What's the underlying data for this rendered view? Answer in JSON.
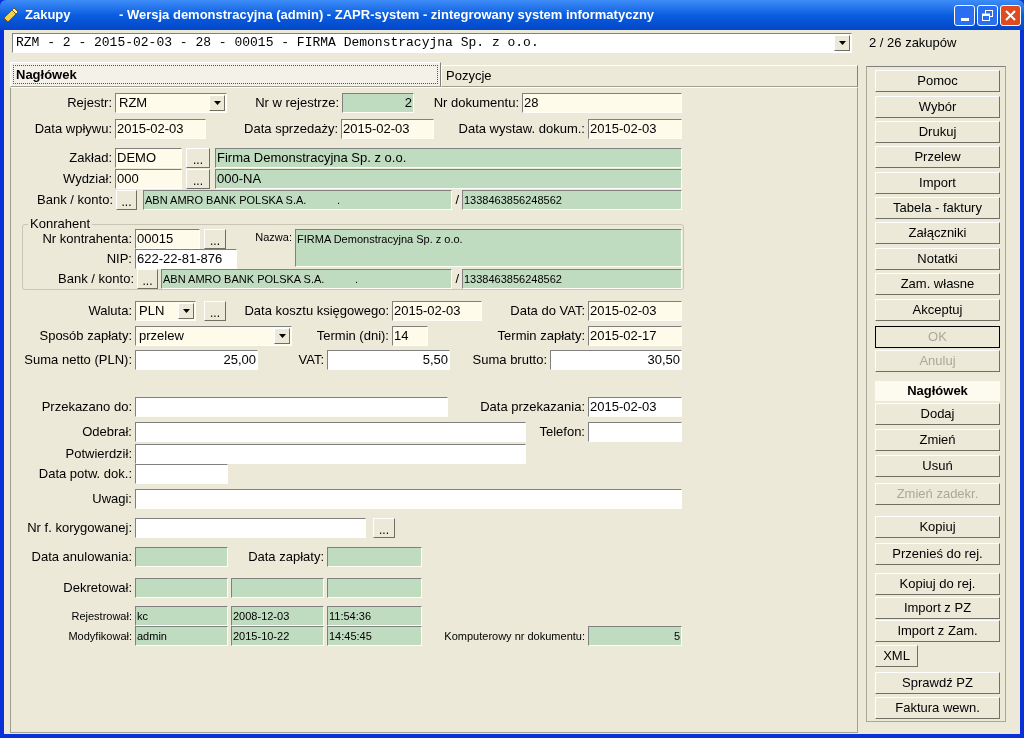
{
  "window": {
    "title": "Zakupy",
    "subtitle": "- Wersja demonstracyjna (admin) - ZAPR-system - zintegrowany system informatyczny"
  },
  "record_selector": {
    "value": "RZM - 2 - 2015-02-03 - 28 - 00015 - FIRMA Demonstracyjna Sp. z o.o."
  },
  "record_counter": "2 / 26 zakupów",
  "tabs": [
    {
      "label": "Nagłówek",
      "selected": true
    },
    {
      "label": "Pozycje",
      "selected": false
    }
  ],
  "top_rows": [
    {
      "items": [
        {
          "kind": "label",
          "text": "Rejestr:"
        },
        {
          "kind": "combo",
          "value": "RZM"
        },
        {
          "kind": "label",
          "text": "Nr w rejestrze:"
        },
        {
          "kind": "readonly",
          "value": "2"
        },
        {
          "kind": "label",
          "text": "Nr dokumentu:"
        },
        {
          "kind": "edit",
          "value": "28"
        }
      ]
    },
    {
      "items": [
        {
          "kind": "label",
          "text": "Data wpływu:"
        },
        {
          "kind": "edit",
          "value": "2015-02-03"
        },
        {
          "kind": "label",
          "text": "Data sprzedaży:"
        },
        {
          "kind": "edit",
          "value": "2015-02-03"
        },
        {
          "kind": "label",
          "text": "Data wystaw. dokum.:"
        },
        {
          "kind": "edit",
          "value": "2015-02-03"
        }
      ]
    },
    {
      "items": [
        {
          "kind": "label",
          "text": "Zakład:"
        },
        {
          "kind": "edit",
          "value": "DEMO"
        },
        {
          "kind": "browse",
          "label": "..."
        },
        {
          "kind": "readonly",
          "value": "Firma Demonstracyjna Sp. z o.o."
        }
      ]
    },
    {
      "items": [
        {
          "kind": "label",
          "text": "Wydział:"
        },
        {
          "kind": "edit",
          "value": "000"
        },
        {
          "kind": "browse",
          "label": "..."
        },
        {
          "kind": "readonly",
          "value": "000-NA"
        }
      ]
    },
    {
      "items": [
        {
          "kind": "label",
          "text": "Bank / konto:"
        },
        {
          "kind": "browse",
          "label": "..."
        },
        {
          "kind": "readonly",
          "value": "ABN AMRO BANK POLSKA S.A.          ."
        },
        {
          "kind": "label",
          "text": "/"
        },
        {
          "kind": "readonly",
          "value": "1338463856248562"
        }
      ]
    }
  ],
  "contractor": {
    "title": "Konrahent",
    "rows": [
      {
        "items": [
          {
            "kind": "label",
            "text": "Nr kontrahenta:"
          },
          {
            "kind": "edit",
            "value": "00015"
          },
          {
            "kind": "browse",
            "label": "..."
          },
          {
            "kind": "label",
            "text": "Nazwa:"
          },
          {
            "kind": "area",
            "value": "FIRMA Demonstracyjna Sp. z o.o."
          }
        ]
      },
      {
        "items": [
          {
            "kind": "label",
            "text": "NIP:"
          },
          {
            "kind": "input",
            "value": "622-22-81-876"
          }
        ]
      },
      {
        "items": [
          {
            "kind": "label",
            "text": "Bank / konto:"
          },
          {
            "kind": "browse",
            "label": "..."
          },
          {
            "kind": "readonly",
            "value": "ABN AMRO BANK POLSKA S.A.          ."
          },
          {
            "kind": "label",
            "text": "/"
          },
          {
            "kind": "readonly",
            "value": "1338463856248562"
          }
        ]
      }
    ]
  },
  "rows": [
    {
      "items": [
        {
          "kind": "label",
          "text": "Waluta:"
        },
        {
          "kind": "combo",
          "value": "PLN"
        },
        {
          "kind": "browse",
          "label": "..."
        },
        {
          "kind": "label",
          "text": "Data kosztu księgowego:"
        },
        {
          "kind": "edit",
          "value": "2015-02-03"
        },
        {
          "kind": "label",
          "text": "Data do VAT:"
        },
        {
          "kind": "edit",
          "value": "2015-02-03"
        }
      ]
    },
    {
      "items": [
        {
          "kind": "label",
          "text": "Sposób zapłaty:"
        },
        {
          "kind": "combo",
          "value": "przelew"
        },
        {
          "kind": "label",
          "text": "Termin (dni):"
        },
        {
          "kind": "edit",
          "value": "14"
        },
        {
          "kind": "label",
          "text": "Termin zapłaty:"
        },
        {
          "kind": "edit",
          "value": "2015-02-17"
        }
      ]
    },
    {
      "items": [
        {
          "kind": "label",
          "text": "Suma netto (PLN):"
        },
        {
          "kind": "input",
          "value": "25,00"
        },
        {
          "kind": "label",
          "text": "VAT:"
        },
        {
          "kind": "input",
          "value": "5,50"
        },
        {
          "kind": "label",
          "text": "Suma brutto:"
        },
        {
          "kind": "input",
          "value": "30,50"
        }
      ]
    },
    {
      "items": [
        {
          "kind": "label",
          "text": "Przekazano do:"
        },
        {
          "kind": "input"
        },
        {
          "kind": "label",
          "text": "Data przekazania:"
        },
        {
          "kind": "input",
          "value": "2015-02-03"
        }
      ]
    },
    {
      "items": [
        {
          "kind": "label",
          "text": "Odebrał:"
        },
        {
          "kind": "input"
        },
        {
          "kind": "label",
          "text": "Telefon:"
        },
        {
          "kind": "input"
        }
      ]
    },
    {
      "items": [
        {
          "kind": "label",
          "text": "Potwierdził:"
        },
        {
          "kind": "input"
        }
      ]
    },
    {
      "items": [
        {
          "kind": "label",
          "text": "Data potw. dok.:"
        },
        {
          "kind": "input"
        }
      ]
    },
    {
      "items": [
        {
          "kind": "label",
          "text": "Uwagi:"
        },
        {
          "kind": "input"
        }
      ]
    },
    {
      "items": [
        {
          "kind": "label",
          "text": "Nr f. korygowanej:"
        },
        {
          "kind": "input"
        },
        {
          "kind": "browse",
          "label": "..."
        }
      ]
    },
    {
      "items": [
        {
          "kind": "label",
          "text": "Data anulowania:"
        },
        {
          "kind": "readonly"
        },
        {
          "kind": "label",
          "text": "Data zapłaty:"
        },
        {
          "kind": "readonly"
        }
      ]
    },
    {
      "items": [
        {
          "kind": "label",
          "text": "Dekretował:"
        },
        {
          "kind": "readonly"
        },
        {
          "kind": "readonly"
        },
        {
          "kind": "readonly"
        }
      ]
    },
    {
      "items": [
        {
          "kind": "label",
          "text": "Rejestrował:"
        },
        {
          "kind": "readonly",
          "value": "kc"
        },
        {
          "kind": "readonly",
          "value": "2008-12-03"
        },
        {
          "kind": "readonly",
          "value": "11:54:36"
        }
      ]
    },
    {
      "items": [
        {
          "kind": "label",
          "text": "Modyfikował:"
        },
        {
          "kind": "readonly",
          "value": "admin"
        },
        {
          "kind": "readonly",
          "value": "2015-10-22"
        },
        {
          "kind": "readonly",
          "value": "14:45:45"
        },
        {
          "kind": "label",
          "text": "Komputerowy nr dokumentu:"
        },
        {
          "kind": "readonly",
          "value": "5"
        }
      ]
    }
  ],
  "side_buttons": [
    {
      "kind": "button",
      "label": "Pomoc",
      "disabled": false,
      "default": false
    },
    {
      "kind": "button",
      "label": "Wybór",
      "disabled": false,
      "default": false
    },
    {
      "kind": "button",
      "label": "Drukuj",
      "disabled": false,
      "default": false
    },
    {
      "kind": "button",
      "label": "Przelew",
      "disabled": false,
      "default": false
    },
    {
      "kind": "button",
      "label": "Import",
      "disabled": false,
      "default": false
    },
    {
      "kind": "button",
      "label": "Tabela - faktury",
      "disabled": false,
      "default": false
    },
    {
      "kind": "button",
      "label": "Załączniki",
      "disabled": false,
      "default": false
    },
    {
      "kind": "button",
      "label": "Notatki",
      "disabled": false,
      "default": false
    },
    {
      "kind": "button",
      "label": "Zam. własne",
      "disabled": false,
      "default": false
    },
    {
      "kind": "button",
      "label": "Akceptuj",
      "disabled": false,
      "default": false
    },
    {
      "kind": "button",
      "label": "OK",
      "disabled": true,
      "default": true
    },
    {
      "kind": "button",
      "label": "Anuluj",
      "disabled": true,
      "default": false
    },
    {
      "kind": "heading",
      "label": "Nagłówek"
    },
    {
      "kind": "button",
      "label": "Dodaj",
      "disabled": false,
      "default": false
    },
    {
      "kind": "button",
      "label": "Zmień",
      "disabled": false,
      "default": false
    },
    {
      "kind": "button",
      "label": "Usuń",
      "disabled": false,
      "default": false
    },
    {
      "kind": "button",
      "label": "Zmień zadekr.",
      "disabled": true,
      "default": false
    },
    {
      "kind": "button",
      "label": "Kopiuj",
      "disabled": false,
      "default": false
    },
    {
      "kind": "button",
      "label": "Przenieś do rej.",
      "disabled": false,
      "default": false
    },
    {
      "kind": "button",
      "label": "Kopiuj do rej.",
      "disabled": false,
      "default": false
    },
    {
      "kind": "button",
      "label": "Import z PZ",
      "disabled": false,
      "default": false
    },
    {
      "kind": "button",
      "label": "Import z Zam.",
      "disabled": false,
      "default": false
    },
    {
      "kind": "button",
      "label": "XML",
      "disabled": false,
      "default": false
    },
    {
      "kind": "button",
      "label": "Sprawdź PZ",
      "disabled": false,
      "default": false
    },
    {
      "kind": "button",
      "label": "Faktura wewn.",
      "disabled": false,
      "default": false
    }
  ]
}
